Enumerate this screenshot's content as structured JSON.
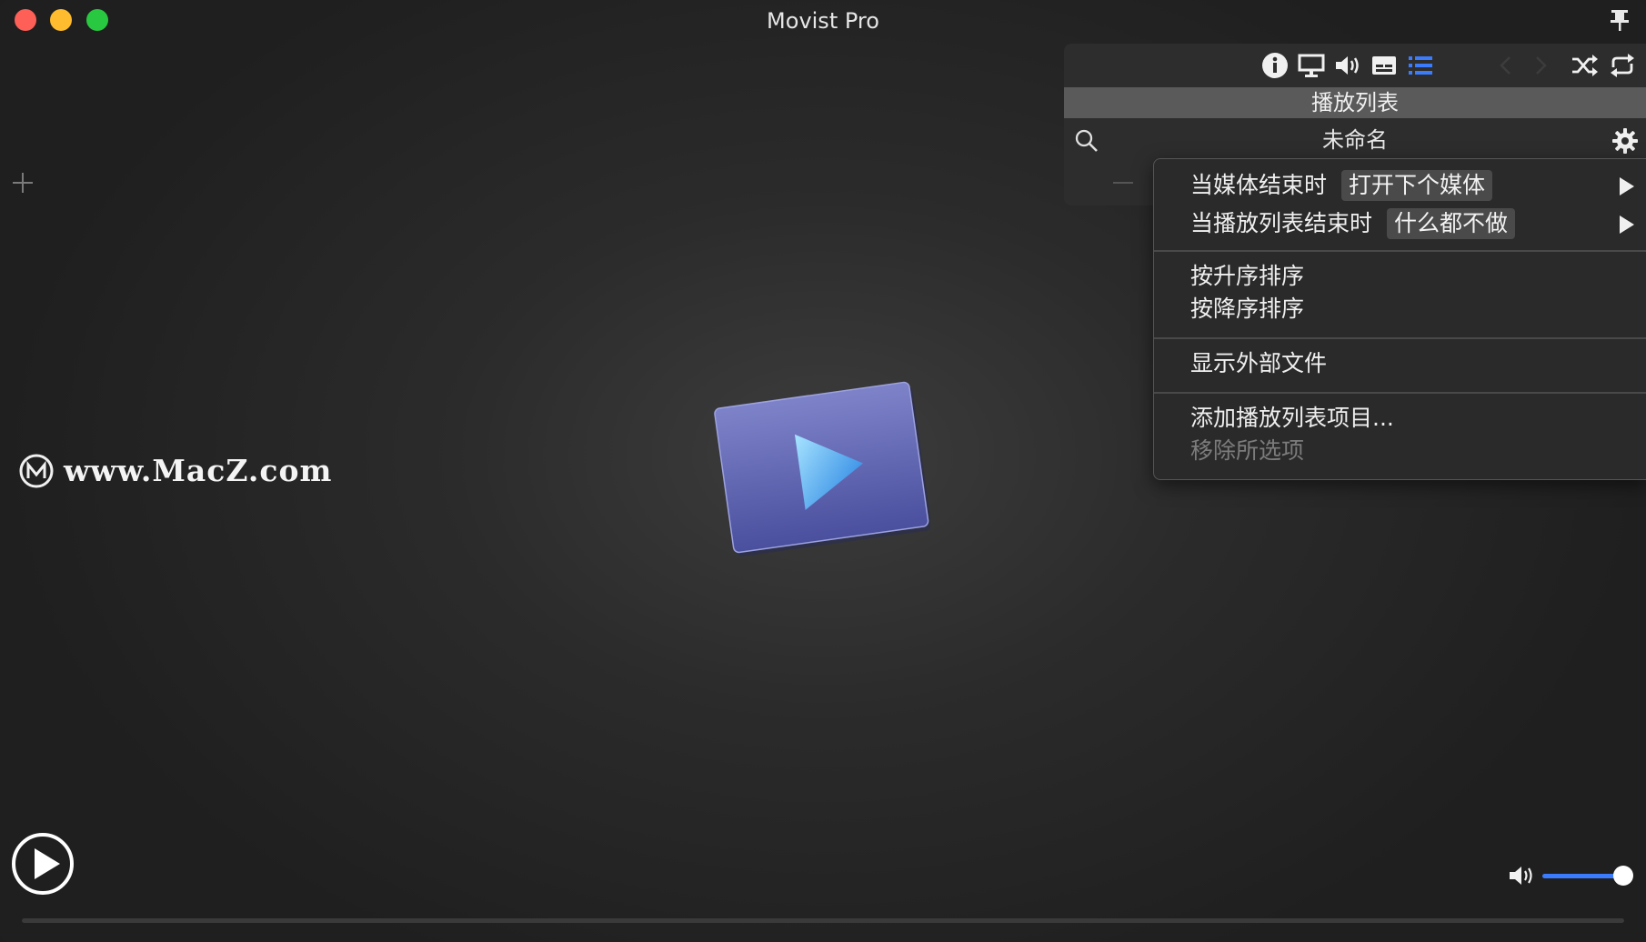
{
  "window": {
    "title": "Movist Pro"
  },
  "playlist": {
    "header": "播放列表",
    "name": "未命名"
  },
  "menu": {
    "on_media_end": {
      "label": "当媒体结束时",
      "value": "打开下个媒体"
    },
    "on_playlist_end": {
      "label": "当播放列表结束时",
      "value": "什么都不做"
    },
    "sort_asc": "按升序排序",
    "sort_desc": "按降序排序",
    "show_external": "显示外部文件",
    "add_items": "添加播放列表项目...",
    "remove_selected": "移除所选项"
  },
  "watermark": {
    "text": "www.MacZ.com"
  },
  "volume": {
    "level": 0.85
  },
  "colors": {
    "accent": "#3b7cff",
    "menu_bg": "#2a2a2a",
    "header_bg": "#5a5a5a"
  }
}
